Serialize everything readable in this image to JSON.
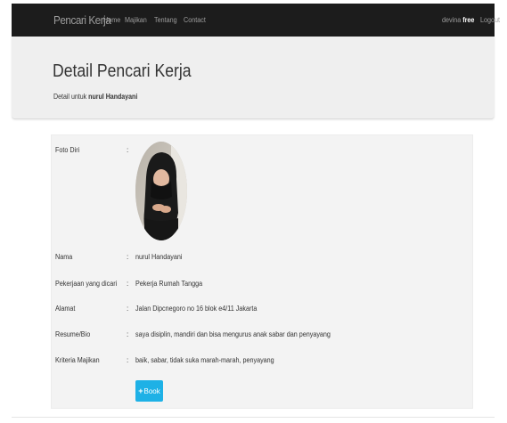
{
  "navbar": {
    "brand": "Pencari Kerja",
    "links": [
      "Home",
      "Majikan",
      "Tentang",
      "Contact"
    ],
    "user_name": "devina",
    "user_plan": "free",
    "logout": "Logout"
  },
  "header": {
    "title": "Detail Pencari Kerja",
    "subtitle_prefix": "Detail untuk",
    "subtitle_name": "nurul Handayani"
  },
  "profile": {
    "separator": ":",
    "rows": [
      {
        "label": "Foto Diri",
        "value": ""
      },
      {
        "label": "Nama",
        "value": "nurul Handayani"
      },
      {
        "label": "Pekerjaan yang dicari",
        "value": "Pekerja Rumah Tangga"
      },
      {
        "label": "Alamat",
        "value": "Jalan Dipcnegoro no 16 blok e4/11 Jakarta"
      },
      {
        "label": "Resume/Bio",
        "value": "saya disiplin, mandiri dan bisa mengurus anak sabar dan penyayang"
      },
      {
        "label": "Kriteria Majikan",
        "value": "baik, sabar, tidak suka marah-marah, penyayang"
      }
    ],
    "book_button": "Book",
    "book_icon": "plus-icon"
  },
  "colors": {
    "navbar_bg": "#1c1c1c",
    "jumbotron_bg": "#efefef",
    "panel_bg": "#f3f3f3",
    "button_bg": "#1eb1e6"
  }
}
